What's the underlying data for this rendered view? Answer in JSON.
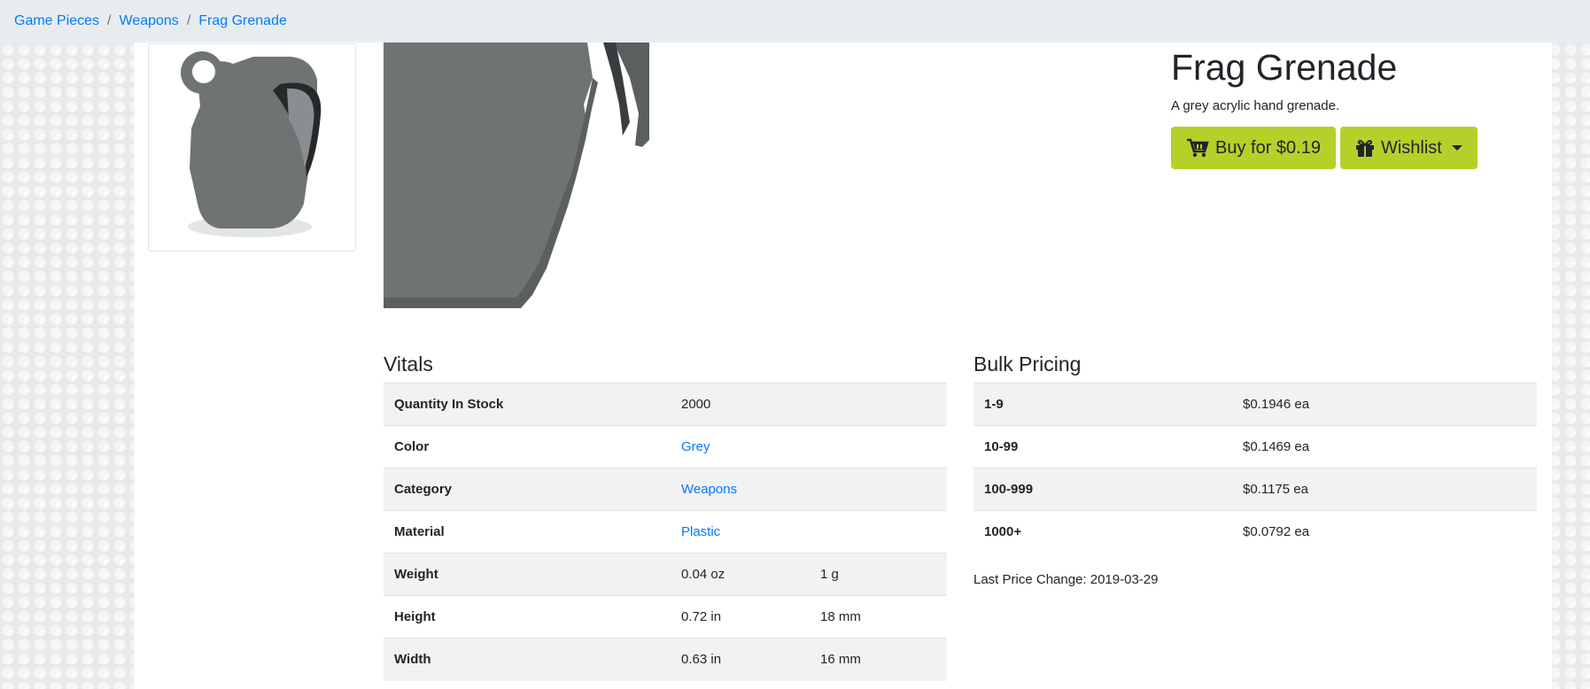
{
  "breadcrumb": [
    {
      "label": "Game Pieces",
      "name": "breadcrumb-game-pieces"
    },
    {
      "label": "Weapons",
      "name": "breadcrumb-weapons"
    },
    {
      "label": "Frag Grenade",
      "name": "breadcrumb-frag-grenade"
    }
  ],
  "product": {
    "title": "Frag Grenade",
    "description": "A grey acrylic hand grenade.",
    "buy_label": "Buy for $0.19",
    "wishlist_label": "Wishlist"
  },
  "vitals": {
    "title": "Vitals",
    "rows": [
      {
        "label": "Quantity In Stock",
        "value": "2000",
        "value2": "",
        "link": false
      },
      {
        "label": "Color",
        "value": "Grey",
        "value2": "",
        "link": true
      },
      {
        "label": "Category",
        "value": "Weapons",
        "value2": "",
        "link": true
      },
      {
        "label": "Material",
        "value": "Plastic",
        "value2": "",
        "link": true
      },
      {
        "label": "Weight",
        "value": "0.04 oz",
        "value2": "1 g",
        "link": false
      },
      {
        "label": "Height",
        "value": "0.72 in",
        "value2": "18 mm",
        "link": false
      },
      {
        "label": "Width",
        "value": "0.63 in",
        "value2": "16 mm",
        "link": false
      }
    ]
  },
  "bulk_pricing": {
    "title": "Bulk Pricing",
    "rows": [
      {
        "qty": "1-9",
        "price": "$0.1946 ea"
      },
      {
        "qty": "10-99",
        "price": "$0.1469 ea"
      },
      {
        "qty": "100-999",
        "price": "$0.1175 ea"
      },
      {
        "qty": "1000+",
        "price": "$0.0792 ea"
      }
    ],
    "last_change": "Last Price Change: 2019-03-29"
  },
  "colors": {
    "accent": "#b6d02a",
    "link": "#007bff",
    "grenade": "#6f7374"
  },
  "icons": {
    "buy": "cart-icon",
    "wishlist": "gift-icon"
  }
}
